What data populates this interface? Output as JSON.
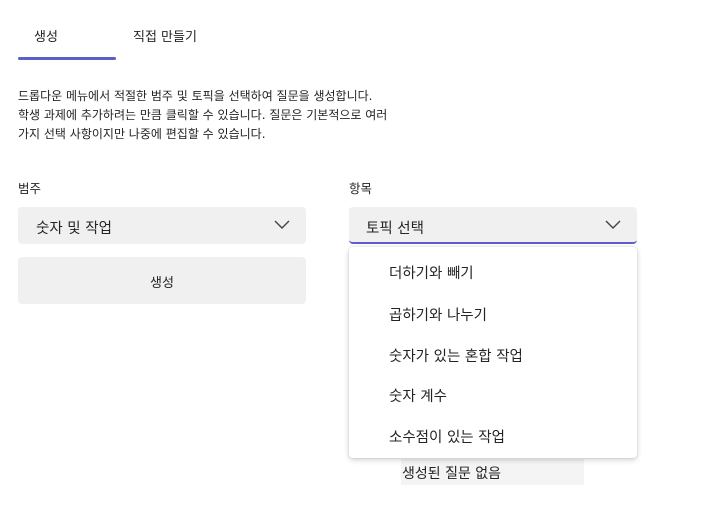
{
  "tabs": [
    {
      "label": "생성",
      "selected": true
    },
    {
      "label": "직접 만들기",
      "selected": false
    }
  ],
  "description": {
    "line1": "드롭다운 메뉴에서 적절한 범주 및 토픽을 선택하여 질문을 생성합니다.",
    "line2": "학생 과제에 추가하려는 만큼 클릭할 수 있습니다. 질문은 기본적으로 여러",
    "line3": "가지 선택 사항이지만 나중에 편집할 수 있습니다."
  },
  "category": {
    "label": "범주",
    "value": "숫자 및 작업"
  },
  "topic": {
    "label": "항목",
    "value": "토픽 선택"
  },
  "generate_button": "생성",
  "topic_options": [
    "더하기와 빼기",
    "곱하기와 나누기",
    "숫자가 있는 혼합 작업",
    "숫자 계수",
    "소수점이 있는 작업"
  ],
  "empty_state": "생성된 질문 없음",
  "colors": {
    "accent": "#5b5fc7",
    "field_bg": "#f0f0f0"
  },
  "icons": {
    "dropdown": "chevron-down-icon"
  }
}
